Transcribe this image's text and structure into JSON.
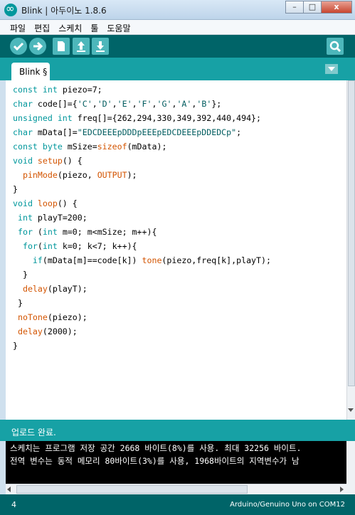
{
  "window": {
    "title": "Blink | 아두이노 1.8.6",
    "minimize": "–",
    "maximize": "□",
    "close": "x"
  },
  "menu": [
    "파일",
    "편집",
    "스케치",
    "툴",
    "도움말"
  ],
  "toolbar": {
    "buttons": [
      "verify-icon",
      "upload-icon",
      "new-icon",
      "open-icon",
      "save-icon",
      "serial-monitor-icon"
    ]
  },
  "tab": {
    "label": "Blink §"
  },
  "code_lines": [
    "const int piezo=7;",
    "char code[]={'C','D','E','F','G','A','B'};",
    "unsigned int freq[]={262,294,330,349,392,440,494};",
    "char mData[]=\"EDCDEEEpDDDpEEEpEDCDEEEpDDEDCp\";",
    "const byte mSize=sizeof(mData);",
    "void setup() {",
    "  pinMode(piezo, OUTPUT);",
    "}",
    "void loop() {",
    " int playT=200;",
    " for (int m=0; m<mSize; m++){",
    "  for(int k=0; k<7; k++){",
    "    if(mData[m]==code[k]) tone(piezo,freq[k],playT);",
    "  }",
    "  delay(playT);",
    " }",
    " noTone(piezo);",
    " delay(2000);",
    "}"
  ],
  "status": {
    "message": "업로드 완료."
  },
  "console": [
    "스케치는 프로그램 저장 공간 2668 바이트(8%)를 사용. 최대 32256 바이트.",
    "전역 변수는 동적 메모리 80바이트(3%)를 사용, 1968바이트의 지역변수가 남"
  ],
  "footer": {
    "line_number": "4",
    "board": "Arduino/Genuino Uno on COM12"
  },
  "colors": {
    "toolbar": "#006468",
    "tabstrip": "#17a1a5",
    "button": "#4db7bb",
    "keyword": "#00979c",
    "function": "#d35400"
  }
}
